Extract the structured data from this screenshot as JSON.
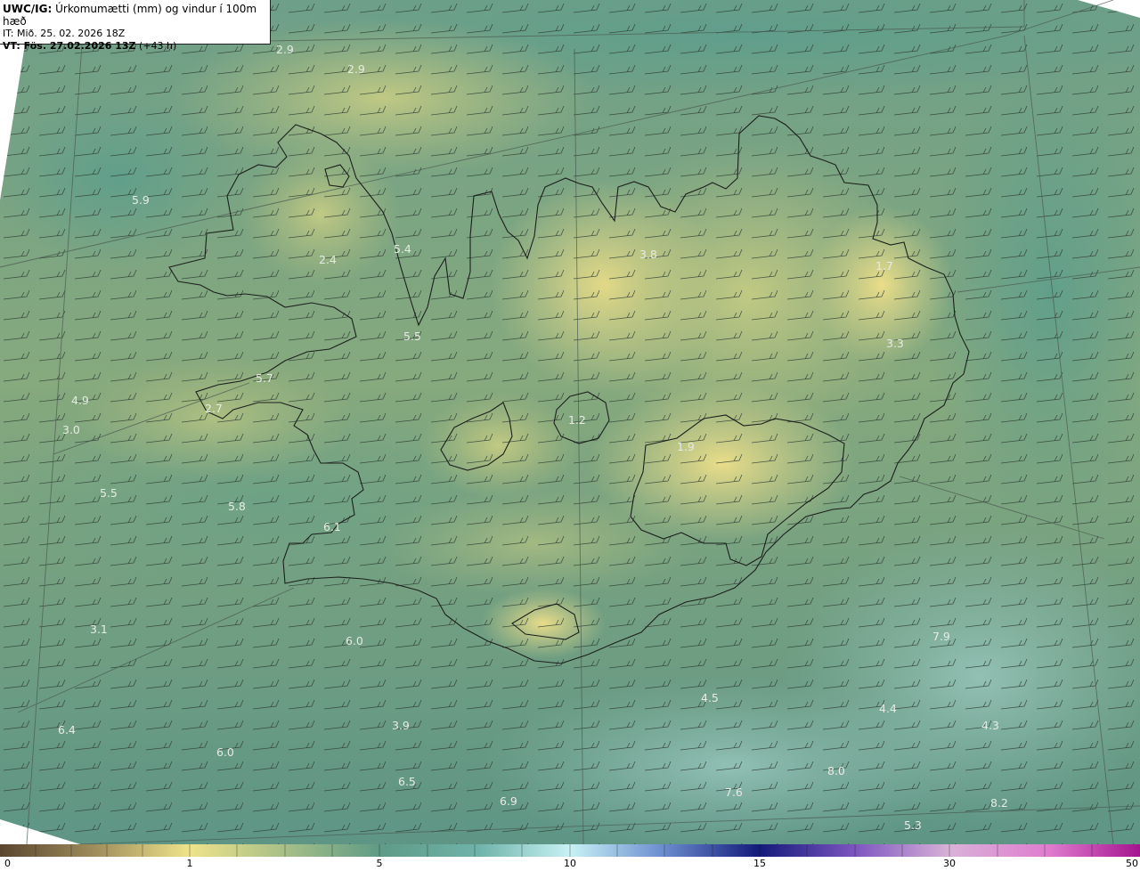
{
  "header": {
    "title_bold": "UWC/IG:",
    "title_rest": " Úrkomumætti (mm) og vindur í 100m hæð",
    "init_time": "IT: Mið. 25. 02. 2026 18Z",
    "valid_bold": "VT: Fös. 27.02.2026 13Z",
    "valid_rest": " (+43 h)"
  },
  "colorbar": {
    "ticks": [
      "0",
      "1",
      "5",
      "10",
      "15",
      "30",
      "50"
    ]
  },
  "map_labels": [
    {
      "text": "2.9",
      "pos": "p0"
    },
    {
      "text": "2.9",
      "pos": "p1"
    },
    {
      "text": "5.9",
      "pos": "p2"
    },
    {
      "text": "2.4",
      "pos": "p3"
    },
    {
      "text": "5.4",
      "pos": "p4"
    },
    {
      "text": "3.8",
      "pos": "p5"
    },
    {
      "text": "1.7",
      "pos": "p6"
    },
    {
      "text": "5.5",
      "pos": "p7"
    },
    {
      "text": "3.3",
      "pos": "p8"
    },
    {
      "text": "5.7",
      "pos": "p9"
    },
    {
      "text": "4.9",
      "pos": "p10"
    },
    {
      "text": "2.7",
      "pos": "p11"
    },
    {
      "text": "3.0",
      "pos": "p12"
    },
    {
      "text": "1.2",
      "pos": "p13"
    },
    {
      "text": "1.9",
      "pos": "p14"
    },
    {
      "text": "5.5",
      "pos": "p15"
    },
    {
      "text": "5.8",
      "pos": "p16"
    },
    {
      "text": "6.1",
      "pos": "p17"
    },
    {
      "text": "3.1",
      "pos": "p18"
    },
    {
      "text": "6.0",
      "pos": "p19"
    },
    {
      "text": "7.9",
      "pos": "p20"
    },
    {
      "text": "4.5",
      "pos": "p21"
    },
    {
      "text": "4.4",
      "pos": "p22"
    },
    {
      "text": "6.4",
      "pos": "p23"
    },
    {
      "text": "3.9",
      "pos": "p24"
    },
    {
      "text": "4.3",
      "pos": "p25"
    },
    {
      "text": "6.0",
      "pos": "p26"
    },
    {
      "text": "8.0",
      "pos": "p27"
    },
    {
      "text": "6.5",
      "pos": "p28"
    },
    {
      "text": "7.6",
      "pos": "p29"
    },
    {
      "text": "6.9",
      "pos": "p30"
    },
    {
      "text": "8.2",
      "pos": "p31"
    },
    {
      "text": "5.3",
      "pos": "p32"
    }
  ]
}
